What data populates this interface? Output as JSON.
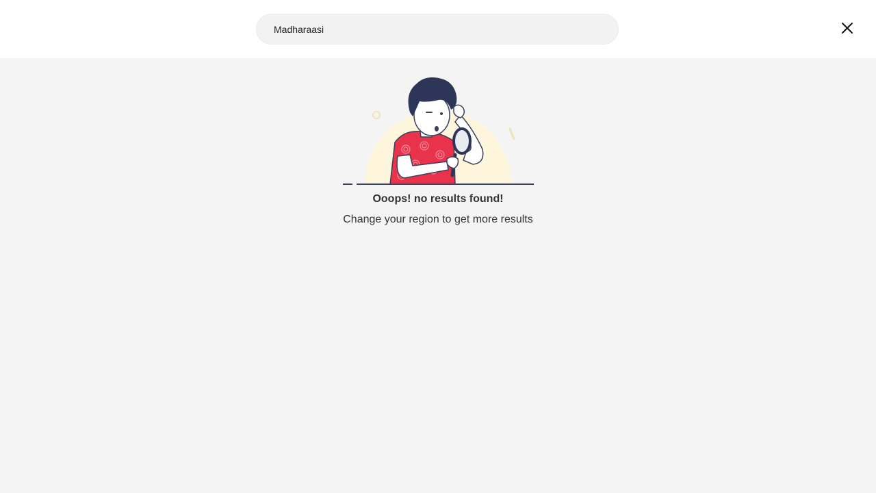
{
  "search": {
    "value": "Madharaasi"
  },
  "empty_state": {
    "title": "Ooops! no results found!",
    "subtitle": "Change your region to get more results"
  },
  "icons": {
    "close": "close-icon",
    "illustration": "no-results-illustration"
  },
  "colors": {
    "page_background": "#f4f4f4",
    "header_background": "#ffffff",
    "search_background": "#f2f2f2",
    "shirt_red": "#e8334a",
    "hair_navy": "#2d3559"
  }
}
